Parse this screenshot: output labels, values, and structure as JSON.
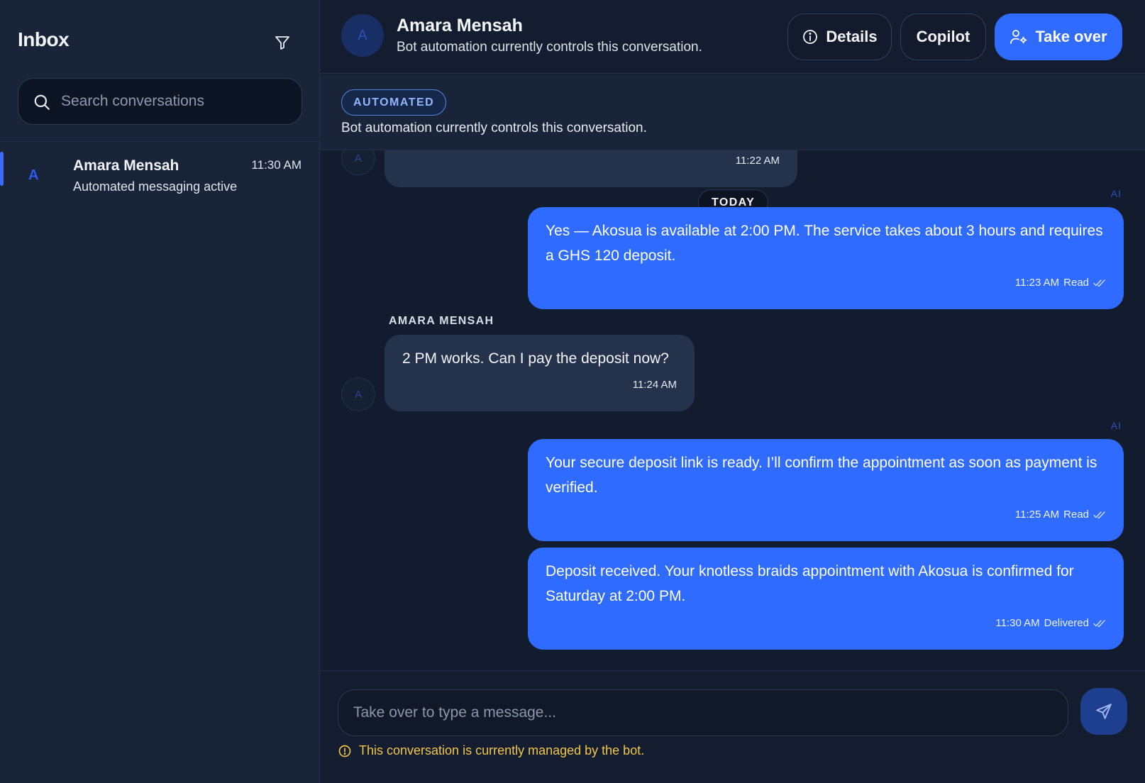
{
  "sidebar": {
    "title": "Inbox",
    "search_placeholder": "Search conversations",
    "conversations": [
      {
        "avatar": "A",
        "name": "Amara Mensah",
        "time": "11:30 AM",
        "preview": "Automated messaging active",
        "active": true
      }
    ]
  },
  "header": {
    "avatar": "A",
    "name": "Amara Mensah",
    "subtitle": "Bot automation currently controls this conversation.",
    "details_label": "Details",
    "copilot_label": "Copilot",
    "takeover_label": "Take over"
  },
  "banner": {
    "badge": "AUTOMATED",
    "text": "Bot automation currently controls this conversation."
  },
  "thread": {
    "date_divider": "TODAY",
    "sender_label": "AMARA MENSAH",
    "messages": [
      {
        "direction": "in",
        "avatar": "A",
        "text": "",
        "time": "11:22 AM"
      },
      {
        "direction": "out",
        "tag": "AI",
        "text": "Yes — Akosua is available at 2:00 PM. The service takes about 3 hours and requires a GHS 120 deposit.",
        "time": "11:23 AM",
        "status": "Read"
      },
      {
        "direction": "in",
        "avatar": "A",
        "text": "2 PM works. Can I pay the deposit now?",
        "time": "11:24 AM"
      },
      {
        "direction": "out",
        "tag": "AI",
        "text": "Your secure deposit link is ready. I’ll confirm the appointment as soon as payment is verified.",
        "time": "11:25 AM",
        "status": "Read"
      },
      {
        "direction": "out",
        "text": "Deposit received. Your knotless braids appointment with Akosua is confirmed for Saturday at 2:00 PM.",
        "time": "11:30 AM",
        "status": "Delivered"
      }
    ]
  },
  "composer": {
    "placeholder": "Take over to type a message...",
    "notice": "This conversation is currently managed by the bot."
  },
  "colors": {
    "accent": "#2f6bff",
    "warning": "#f1c64a",
    "background": "#131c2e"
  },
  "icons": [
    "filter-icon",
    "search-icon",
    "info-icon",
    "user-cog-icon",
    "send-icon",
    "double-check-icon",
    "alert-circle-icon"
  ]
}
